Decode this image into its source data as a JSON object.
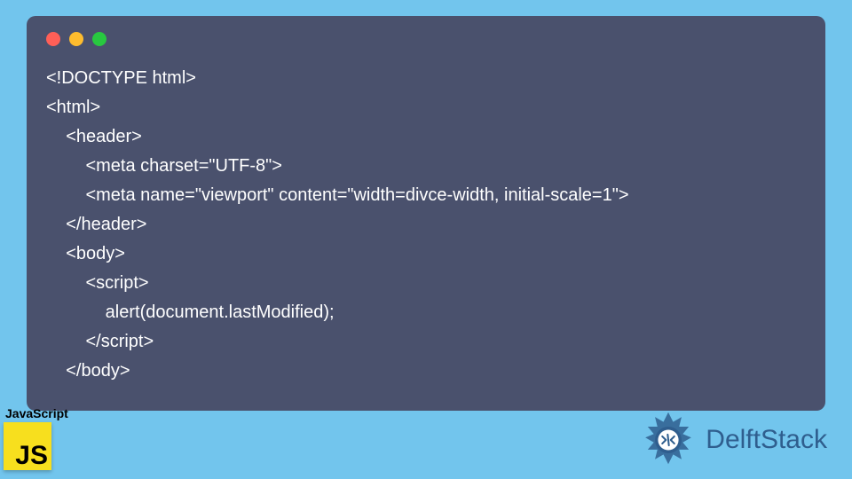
{
  "window": {
    "dots": [
      "red",
      "yellow",
      "green"
    ]
  },
  "code": {
    "lines": [
      "<!DOCTYPE html>",
      "<html>",
      "    <header>",
      "        <meta charset=\"UTF-8\">",
      "        <meta name=\"viewport\" content=\"width=divce-width, initial-scale=1\">",
      "    </header>",
      "    <body>",
      "        <script>",
      "            alert(document.lastModified);",
      "        </script>",
      "    </body>"
    ]
  },
  "footer": {
    "js_label": "JavaScript",
    "js_logo_text": "JS",
    "brand_text": "DelftStack"
  },
  "colors": {
    "page_bg": "#72c5ed",
    "window_bg": "#4a516d",
    "js_yellow": "#f7df1e",
    "brand_blue": "#2f5e8e"
  }
}
